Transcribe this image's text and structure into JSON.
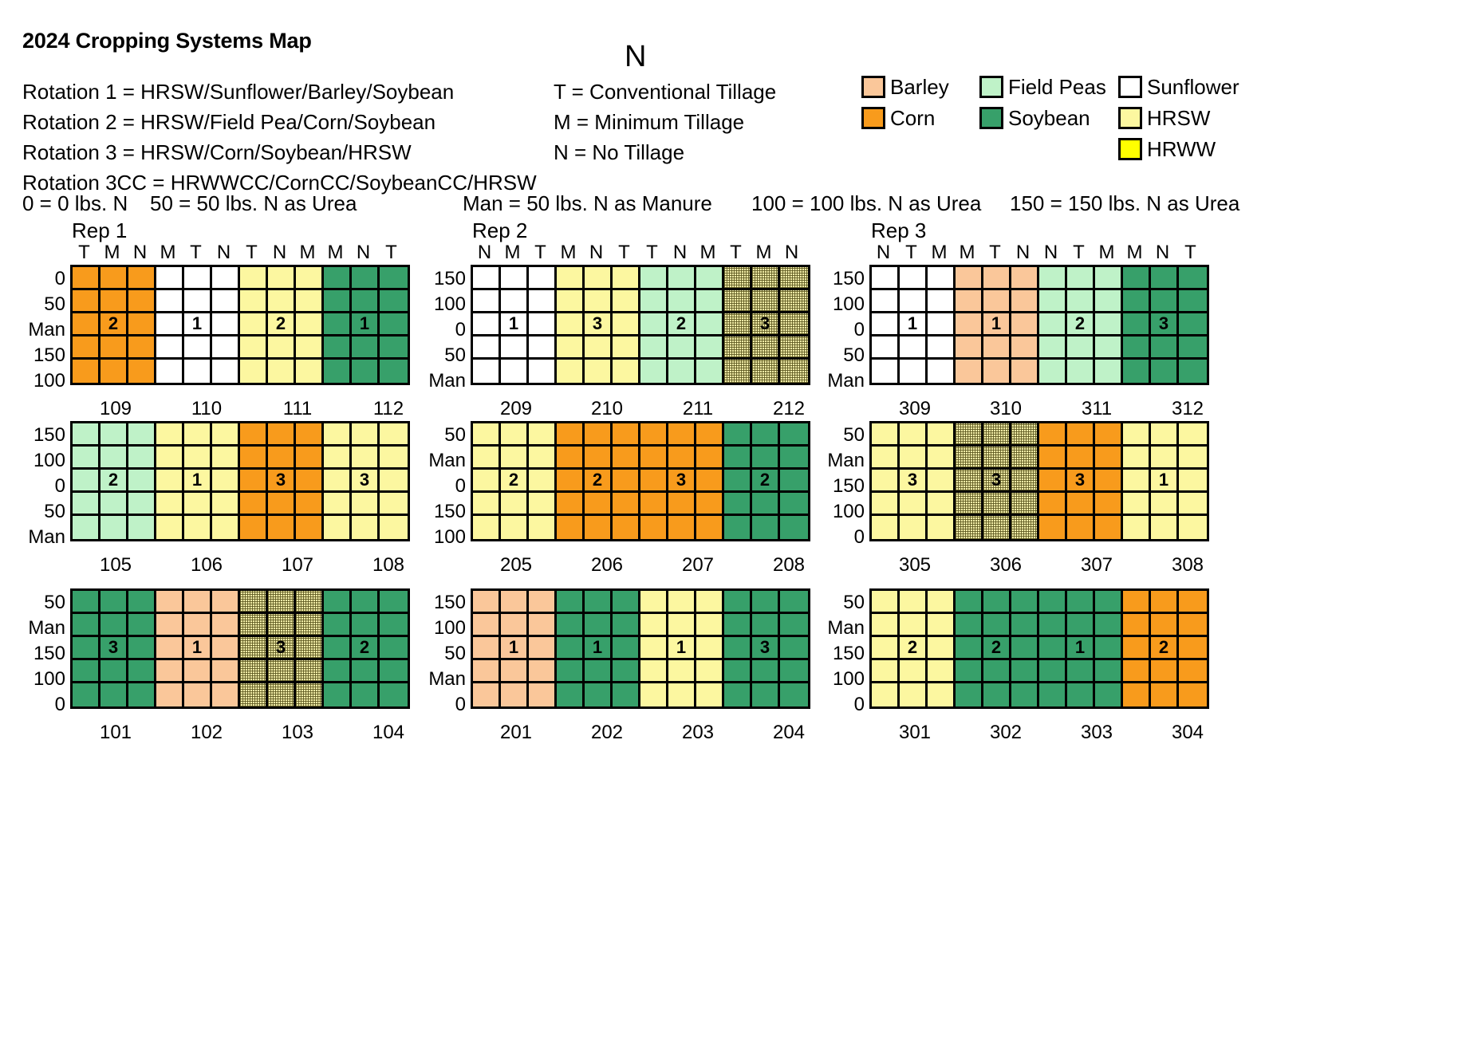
{
  "title": "2024 Cropping Systems Map",
  "compass": "N",
  "rotations": [
    "Rotation 1 = HRSW/Sunflower/Barley/Soybean",
    "Rotation 2 = HRSW/Field Pea/Corn/Soybean",
    "Rotation 3 = HRSW/Corn/Soybean/HRSW",
    "Rotation 3CC = HRWWCC/CornCC/SoybeanCC/HRSW"
  ],
  "tillage": [
    "T = Conventional Tillage",
    "M = Minimum Tillage",
    "N = No Tillage"
  ],
  "nrates": {
    "zero": "0 = 0 lbs. N",
    "fifty": "50 = 50 lbs. N as Urea",
    "manure": "Man = 50 lbs. N as Manure",
    "hundred": "100 = 100 lbs. N as Urea",
    "onefifty": "150 = 150 lbs. N as Urea"
  },
  "crop_legend": [
    {
      "label": "Barley",
      "color": "#FAC79A",
      "col": 0,
      "row": 0
    },
    {
      "label": "Corn",
      "color": "#F89B1C",
      "col": 0,
      "row": 1
    },
    {
      "label": "Field Peas",
      "color": "#BFF2C8",
      "col": 1,
      "row": 0
    },
    {
      "label": "Soybean",
      "color": "#37A06A",
      "col": 1,
      "row": 1
    },
    {
      "label": "Sunflower",
      "color": "#FFFFFF",
      "col": 2,
      "row": 0
    },
    {
      "label": "HRSW",
      "color": "#FCF7A0",
      "col": 2,
      "row": 1
    },
    {
      "label": "HRWW",
      "color": "#FFFF00",
      "col": 2,
      "row": 2
    }
  ],
  "blocks": [
    {
      "id": "rep1-row1",
      "rep_label": "Rep 1",
      "tillage_headers": [
        "T",
        "M",
        "N",
        "M",
        "T",
        "N",
        "T",
        "N",
        "M",
        "M",
        "N",
        "T"
      ],
      "row_labels": [
        "0",
        "50",
        "Man",
        "150",
        "100"
      ],
      "plot_numbers": [
        "109",
        "110",
        "111",
        "112"
      ],
      "crops": [
        "corn",
        "sunflower",
        "hrsw",
        "soybean"
      ],
      "rotation_labels": [
        "2",
        "1",
        "2",
        "1"
      ],
      "rotation_row": 2,
      "rotation_col_in_plot": 1
    },
    {
      "id": "rep2-row1",
      "rep_label": "Rep 2",
      "tillage_headers": [
        "N",
        "M",
        "T",
        "M",
        "N",
        "T",
        "T",
        "N",
        "M",
        "T",
        "M",
        "N"
      ],
      "row_labels": [
        "150",
        "100",
        "0",
        "50",
        "Man"
      ],
      "plot_numbers": [
        "209",
        "210",
        "211",
        "212"
      ],
      "crops": [
        "sunflower",
        "hrsw",
        "fieldpeas",
        "cc"
      ],
      "rotation_labels": [
        "1",
        "3",
        "2",
        "3"
      ],
      "rotation_row": 2,
      "rotation_col_in_plot": 1
    },
    {
      "id": "rep3-row1",
      "rep_label": "Rep 3",
      "tillage_headers": [
        "N",
        "T",
        "M",
        "M",
        "T",
        "N",
        "N",
        "T",
        "M",
        "M",
        "N",
        "T"
      ],
      "row_labels": [
        "150",
        "100",
        "0",
        "50",
        "Man"
      ],
      "plot_numbers": [
        "309",
        "310",
        "311",
        "312"
      ],
      "crops": [
        "sunflower",
        "barley",
        "fieldpeas",
        "soybean"
      ],
      "rotation_labels": [
        "1",
        "1",
        "2",
        "3"
      ],
      "rotation_row": 2,
      "rotation_col_in_plot": 1
    },
    {
      "id": "rep1-row2",
      "rep_label": "",
      "tillage_headers": [
        "",
        "",
        "",
        "",
        "",
        "",
        "",
        "",
        "",
        "",
        "",
        ""
      ],
      "row_labels": [
        "150",
        "100",
        "0",
        "50",
        "Man"
      ],
      "plot_numbers": [
        "105",
        "106",
        "107",
        "108"
      ],
      "crops": [
        "fieldpeas",
        "hrsw",
        "corn",
        "hrsw"
      ],
      "rotation_labels": [
        "2",
        "1",
        "3",
        "3"
      ],
      "rotation_row": 2,
      "rotation_col_in_plot": 1
    },
    {
      "id": "rep2-row2",
      "rep_label": "",
      "tillage_headers": [
        "",
        "",
        "",
        "",
        "",
        "",
        "",
        "",
        "",
        "",
        "",
        ""
      ],
      "row_labels": [
        "50",
        "Man",
        "0",
        "150",
        "100"
      ],
      "plot_numbers": [
        "205",
        "206",
        "207",
        "208"
      ],
      "crops": [
        "hrsw",
        "corn",
        "corn",
        "soybean"
      ],
      "rotation_labels": [
        "2",
        "2",
        "3",
        "2"
      ],
      "rotation_row": 2,
      "rotation_col_in_plot": 1
    },
    {
      "id": "rep3-row2",
      "rep_label": "",
      "tillage_headers": [
        "",
        "",
        "",
        "",
        "",
        "",
        "",
        "",
        "",
        "",
        "",
        ""
      ],
      "row_labels": [
        "50",
        "Man",
        "150",
        "100",
        "0"
      ],
      "plot_numbers": [
        "305",
        "306",
        "307",
        "308"
      ],
      "crops": [
        "hrsw",
        "cc",
        "corn",
        "hrsw"
      ],
      "rotation_labels": [
        "3",
        "3",
        "3",
        "1"
      ],
      "rotation_row": 2,
      "rotation_col_in_plot": 1
    },
    {
      "id": "rep1-row3",
      "rep_label": "",
      "tillage_headers": [
        "",
        "",
        "",
        "",
        "",
        "",
        "",
        "",
        "",
        "",
        "",
        ""
      ],
      "row_labels": [
        "50",
        "Man",
        "150",
        "100",
        "0"
      ],
      "plot_numbers": [
        "101",
        "102",
        "103",
        "104"
      ],
      "crops": [
        "soybean",
        "barley",
        "cc",
        "soybean"
      ],
      "rotation_labels": [
        "3",
        "1",
        "3",
        "2"
      ],
      "rotation_row": 2,
      "rotation_col_in_plot": 1
    },
    {
      "id": "rep2-row3",
      "rep_label": "",
      "tillage_headers": [
        "",
        "",
        "",
        "",
        "",
        "",
        "",
        "",
        "",
        "",
        "",
        ""
      ],
      "row_labels": [
        "150",
        "100",
        "50",
        "Man",
        "0"
      ],
      "plot_numbers": [
        "201",
        "202",
        "203",
        "204"
      ],
      "crops": [
        "barley",
        "soybean",
        "hrsw",
        "soybean"
      ],
      "rotation_labels": [
        "1",
        "1",
        "1",
        "3"
      ],
      "rotation_row": 2,
      "rotation_col_in_plot": 1
    },
    {
      "id": "rep3-row3",
      "rep_label": "",
      "tillage_headers": [
        "",
        "",
        "",
        "",
        "",
        "",
        "",
        "",
        "",
        "",
        "",
        ""
      ],
      "row_labels": [
        "50",
        "Man",
        "150",
        "100",
        "0"
      ],
      "plot_numbers": [
        "301",
        "302",
        "303",
        "304"
      ],
      "crops": [
        "hrsw",
        "soybean",
        "soybean",
        "corn"
      ],
      "rotation_labels": [
        "2",
        "2",
        "1",
        "2"
      ],
      "rotation_row": 2,
      "rotation_col_in_plot": 1
    }
  ]
}
